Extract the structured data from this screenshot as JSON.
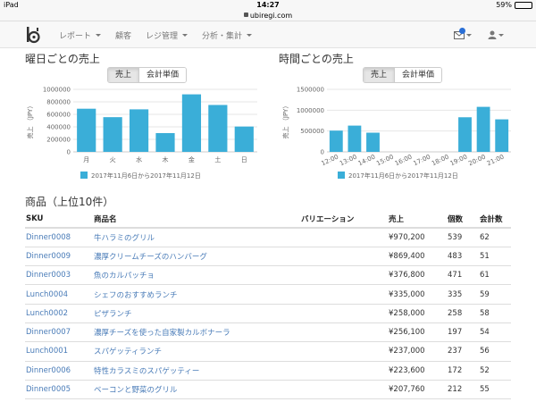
{
  "status": {
    "device": "iPad",
    "time": "14:27",
    "battery": "59%",
    "battery_level": 0.59
  },
  "url": "ubiregi.com",
  "nav": {
    "items": [
      {
        "label": "レポート",
        "dropdown": true
      },
      {
        "label": "顧客",
        "dropdown": false
      },
      {
        "label": "レジ管理",
        "dropdown": true
      },
      {
        "label": "分析・集計",
        "dropdown": true
      }
    ]
  },
  "weekday_section": {
    "title": "曜日ごとの売上",
    "buttons": [
      "売上",
      "会計単価"
    ],
    "active": 0
  },
  "hourly_section": {
    "title": "時間ごとの売上",
    "buttons": [
      "売上",
      "会計単価"
    ],
    "active": 0
  },
  "chart_data": [
    {
      "type": "bar",
      "categories": [
        "月",
        "火",
        "水",
        "木",
        "金",
        "土",
        "日"
      ],
      "series": [
        {
          "name": "2017年11月6日から2017年11月12日",
          "values": [
            690000,
            555000,
            680000,
            300000,
            920000,
            750000,
            405000
          ]
        }
      ],
      "ylabel": "売上 （JPY）",
      "ylim": [
        0,
        1000000
      ],
      "yticks": [
        "0",
        "200000",
        "400000",
        "600000",
        "800000",
        "1000000"
      ],
      "grid": true,
      "legend": "bottom",
      "color": "#3aaed8"
    },
    {
      "type": "bar",
      "categories": [
        "12:00",
        "13:00",
        "14:00",
        "15:00",
        "16:00",
        "17:00",
        "18:00",
        "19:00",
        "20:00",
        "21:00"
      ],
      "series": [
        {
          "name": "2017年11月6日から2017年11月12日",
          "values": [
            510000,
            630000,
            460000,
            0,
            0,
            0,
            0,
            830000,
            1080000,
            780000
          ]
        }
      ],
      "ylabel": "売上 （JPY）",
      "ylim": [
        0,
        1500000
      ],
      "yticks": [
        "0",
        "500000",
        "1000000",
        "1500000"
      ],
      "grid": true,
      "legend": "bottom",
      "color": "#3aaed8"
    }
  ],
  "products": {
    "title": "商品（上位10件）",
    "columns": [
      "SKU",
      "商品名",
      "バリエーション",
      "売上",
      "個数",
      "会計数"
    ],
    "rows": [
      [
        "Dinner0008",
        "牛ハラミのグリル",
        "",
        "¥970,200",
        "539",
        "62"
      ],
      [
        "Dinner0009",
        "濃厚クリームチーズのハンバーグ",
        "",
        "¥869,400",
        "483",
        "51"
      ],
      [
        "Dinner0003",
        "魚のカルパッチョ",
        "",
        "¥376,800",
        "471",
        "61"
      ],
      [
        "Lunch0004",
        "シェフのおすすめランチ",
        "",
        "¥335,000",
        "335",
        "59"
      ],
      [
        "Lunch0002",
        "ピザランチ",
        "",
        "¥258,000",
        "258",
        "58"
      ],
      [
        "Dinner0007",
        "濃厚チーズを使った自家製カルボナーラ",
        "",
        "¥256,100",
        "197",
        "54"
      ],
      [
        "Lunch0001",
        "スパゲッティランチ",
        "",
        "¥237,000",
        "237",
        "56"
      ],
      [
        "Dinner0006",
        "特性カラスミのスパゲッティー",
        "",
        "¥223,600",
        "172",
        "52"
      ],
      [
        "Dinner0005",
        "ベーコンと野菜のグリル",
        "",
        "¥207,760",
        "212",
        "55"
      ]
    ]
  }
}
